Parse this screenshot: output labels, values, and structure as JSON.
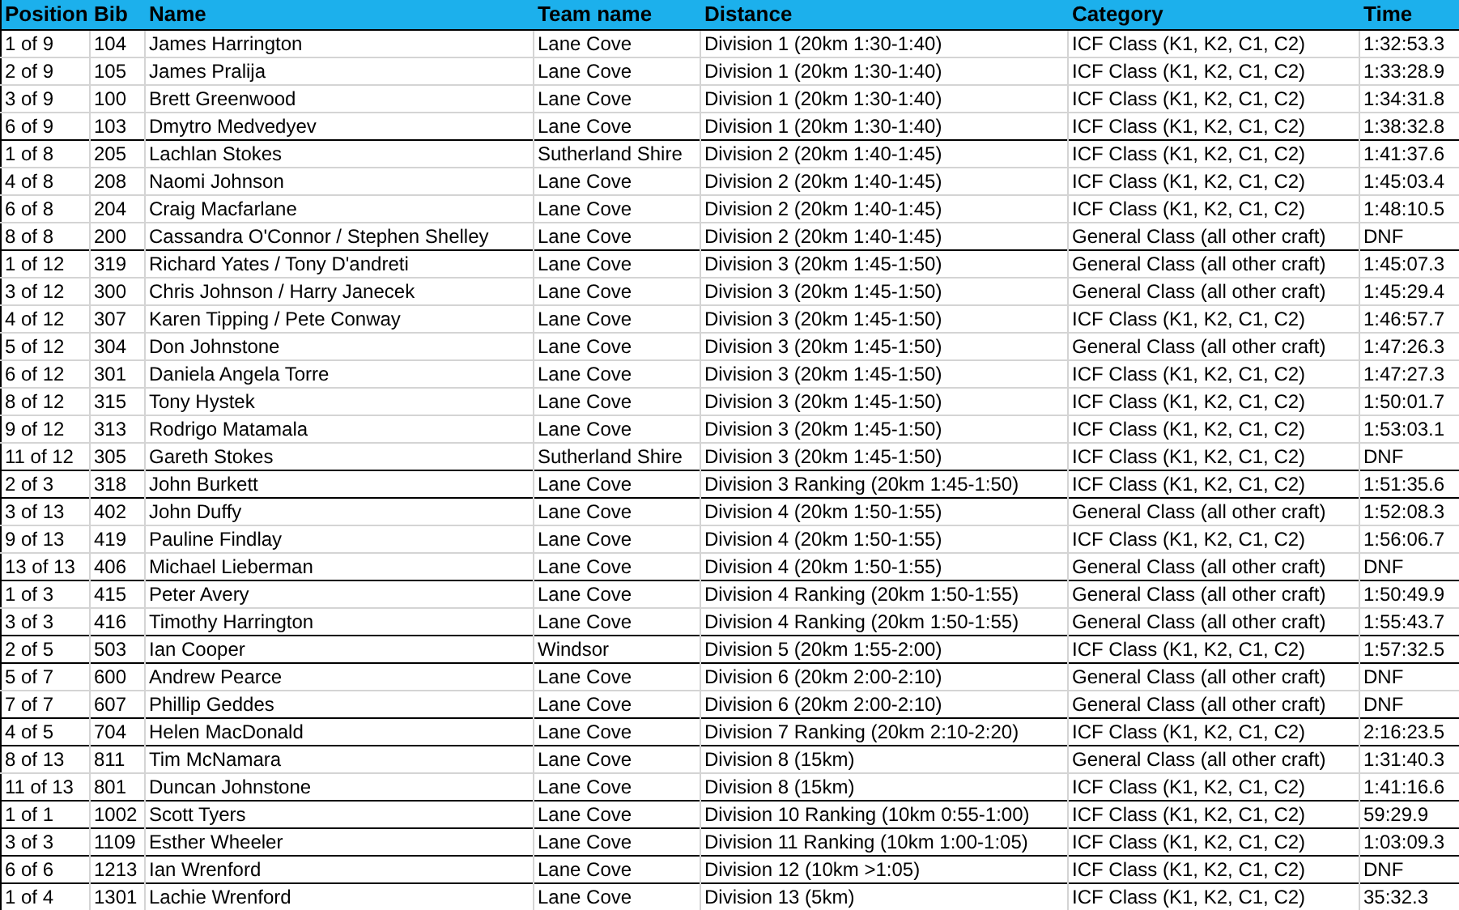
{
  "table": {
    "columns": [
      "Position",
      "Bib",
      "Name",
      "Team name",
      "Distance",
      "Category",
      "Time"
    ],
    "groups": [
      {
        "rows": [
          [
            "1 of 9",
            "104",
            "James Harrington",
            "Lane Cove",
            "Division 1 (20km 1:30-1:40)",
            "ICF Class (K1, K2, C1, C2)",
            "1:32:53.3"
          ],
          [
            "2 of 9",
            "105",
            "James Pralija",
            "Lane Cove",
            "Division 1 (20km 1:30-1:40)",
            "ICF Class (K1, K2, C1, C2)",
            "1:33:28.9"
          ],
          [
            "3 of 9",
            "100",
            "Brett Greenwood",
            "Lane Cove",
            "Division 1 (20km 1:30-1:40)",
            "ICF Class (K1, K2, C1, C2)",
            "1:34:31.8"
          ],
          [
            "6 of 9",
            "103",
            "Dmytro Medvedyev",
            "Lane Cove",
            "Division 1 (20km 1:30-1:40)",
            "ICF Class (K1, K2, C1, C2)",
            "1:38:32.8"
          ]
        ]
      },
      {
        "rows": [
          [
            "1 of 8",
            "205",
            "Lachlan Stokes",
            "Sutherland Shire",
            "Division 2 (20km 1:40-1:45)",
            "ICF Class (K1, K2, C1, C2)",
            "1:41:37.6"
          ],
          [
            "4 of 8",
            "208",
            "Naomi Johnson",
            "Lane Cove",
            "Division 2 (20km 1:40-1:45)",
            "ICF Class (K1, K2, C1, C2)",
            "1:45:03.4"
          ],
          [
            "6 of 8",
            "204",
            "Craig Macfarlane",
            "Lane Cove",
            "Division 2 (20km 1:40-1:45)",
            "ICF Class (K1, K2, C1, C2)",
            "1:48:10.5"
          ],
          [
            "8 of 8",
            "200",
            "Cassandra O'Connor / Stephen Shelley",
            "Lane Cove",
            "Division 2 (20km 1:40-1:45)",
            "General Class (all other craft)",
            "DNF"
          ]
        ]
      },
      {
        "rows": [
          [
            "1 of 12",
            "319",
            "Richard Yates / Tony D'andreti",
            "Lane Cove",
            "Division 3 (20km 1:45-1:50)",
            "General Class (all other craft)",
            "1:45:07.3"
          ],
          [
            "3 of 12",
            "300",
            "Chris Johnson / Harry Janecek",
            "Lane Cove",
            "Division 3 (20km 1:45-1:50)",
            "General Class (all other craft)",
            "1:45:29.4"
          ],
          [
            "4 of 12",
            "307",
            "Karen Tipping / Pete Conway",
            "Lane Cove",
            "Division 3 (20km 1:45-1:50)",
            "ICF Class (K1, K2, C1, C2)",
            "1:46:57.7"
          ],
          [
            "5 of 12",
            "304",
            "Don Johnstone",
            "Lane Cove",
            "Division 3 (20km 1:45-1:50)",
            "General Class (all other craft)",
            "1:47:26.3"
          ],
          [
            "6 of 12",
            "301",
            "Daniela Angela Torre",
            "Lane Cove",
            "Division 3 (20km 1:45-1:50)",
            "ICF Class (K1, K2, C1, C2)",
            "1:47:27.3"
          ],
          [
            "8 of 12",
            "315",
            "Tony Hystek",
            "Lane Cove",
            "Division 3 (20km 1:45-1:50)",
            "ICF Class (K1, K2, C1, C2)",
            "1:50:01.7"
          ],
          [
            "9 of 12",
            "313",
            "Rodrigo Matamala",
            "Lane Cove",
            "Division 3 (20km 1:45-1:50)",
            "ICF Class (K1, K2, C1, C2)",
            "1:53:03.1"
          ],
          [
            "11 of 12",
            "305",
            "Gareth Stokes",
            "Sutherland Shire",
            "Division 3 (20km 1:45-1:50)",
            "ICF Class (K1, K2, C1, C2)",
            "DNF"
          ]
        ]
      },
      {
        "rows": [
          [
            "2 of 3",
            "318",
            "John Burkett",
            "Lane Cove",
            "Division 3 Ranking (20km 1:45-1:50)",
            "ICF Class (K1, K2, C1, C2)",
            "1:51:35.6"
          ]
        ]
      },
      {
        "rows": [
          [
            "3 of 13",
            "402",
            "John Duffy",
            "Lane Cove",
            "Division 4 (20km 1:50-1:55)",
            "General Class (all other craft)",
            "1:52:08.3"
          ],
          [
            "9 of 13",
            "419",
            "Pauline Findlay",
            "Lane Cove",
            "Division 4 (20km 1:50-1:55)",
            "ICF Class (K1, K2, C1, C2)",
            "1:56:06.7"
          ],
          [
            "13 of 13",
            "406",
            "Michael Lieberman",
            "Lane Cove",
            "Division 4 (20km 1:50-1:55)",
            "General Class (all other craft)",
            "DNF"
          ]
        ]
      },
      {
        "rows": [
          [
            "1 of 3",
            "415",
            "Peter Avery",
            "Lane Cove",
            "Division 4 Ranking (20km 1:50-1:55)",
            "General Class (all other craft)",
            "1:50:49.9"
          ],
          [
            "3 of 3",
            "416",
            "Timothy Harrington",
            "Lane Cove",
            "Division 4 Ranking (20km 1:50-1:55)",
            "General Class (all other craft)",
            "1:55:43.7"
          ]
        ]
      },
      {
        "rows": [
          [
            "2 of 5",
            "503",
            "Ian Cooper",
            "Windsor",
            "Division 5 (20km 1:55-2:00)",
            "ICF Class (K1, K2, C1, C2)",
            "1:57:32.5"
          ]
        ]
      },
      {
        "rows": [
          [
            "5 of 7",
            "600",
            "Andrew Pearce",
            "Lane Cove",
            "Division 6 (20km 2:00-2:10)",
            "General Class (all other craft)",
            "DNF"
          ],
          [
            "7 of 7",
            "607",
            "Phillip Geddes",
            "Lane Cove",
            "Division 6 (20km 2:00-2:10)",
            "General Class (all other craft)",
            "DNF"
          ]
        ]
      },
      {
        "rows": [
          [
            "4 of 5",
            "704",
            "Helen MacDonald",
            "Lane Cove",
            "Division 7 Ranking (20km 2:10-2:20)",
            "ICF Class (K1, K2, C1, C2)",
            "2:16:23.5"
          ]
        ]
      },
      {
        "rows": [
          [
            "8 of 13",
            "811",
            "Tim McNamara",
            "Lane Cove",
            "Division 8 (15km)",
            "General Class (all other craft)",
            "1:31:40.3"
          ],
          [
            "11 of 13",
            "801",
            "Duncan Johnstone",
            "Lane Cove",
            "Division 8 (15km)",
            "ICF Class (K1, K2, C1, C2)",
            "1:41:16.6"
          ]
        ]
      },
      {
        "rows": [
          [
            "1 of 1",
            "1002",
            "Scott Tyers",
            "Lane Cove",
            "Division 10 Ranking (10km 0:55-1:00)",
            "ICF Class (K1, K2, C1, C2)",
            "59:29.9"
          ]
        ]
      },
      {
        "rows": [
          [
            "3 of 3",
            "1109",
            "Esther Wheeler",
            "Lane Cove",
            "Division 11 Ranking (10km 1:00-1:05)",
            "ICF Class (K1, K2, C1, C2)",
            "1:03:09.3"
          ]
        ]
      },
      {
        "rows": [
          [
            "6 of 6",
            "1213",
            "Ian Wrenford",
            "Lane Cove",
            "Division 12 (10km >1:05)",
            "ICF Class (K1, K2, C1, C2)",
            "DNF"
          ]
        ]
      },
      {
        "rows": [
          [
            "1 of 4",
            "1301",
            "Lachie Wrenford",
            "Lane Cove",
            "Division 13 (5km)",
            "ICF Class (K1, K2, C1, C2)",
            "35:32.3"
          ]
        ]
      }
    ]
  }
}
